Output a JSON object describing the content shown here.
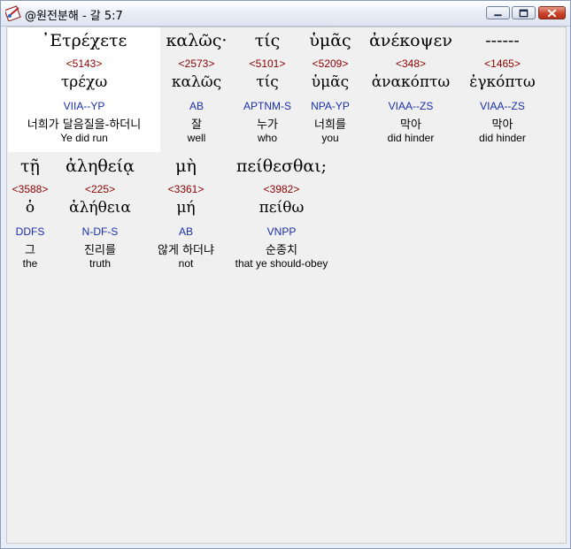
{
  "window": {
    "title": "@원전분해 - 갈 5:7"
  },
  "rows": [
    {
      "words": [
        {
          "greek": "᾿Ετρέχετε",
          "strong": "<5143>",
          "lemma": "τρέχω",
          "parse": "VIIA--YP",
          "korean": "너희가 달음질을-하더니",
          "english": "Ye did run"
        },
        {
          "greek": "καλῶς·",
          "strong": "<2573>",
          "lemma": "καλῶς",
          "parse": "AB",
          "korean": "잘",
          "english": "well"
        },
        {
          "greek": "τίς",
          "strong": "<5101>",
          "lemma": "τίς",
          "parse": "APTNM-S",
          "korean": "누가",
          "english": "who"
        },
        {
          "greek": "ὑμᾶς",
          "strong": "<5209>",
          "lemma": "ὑμᾶς",
          "parse": "NPA-YP",
          "korean": "너희를",
          "english": "you"
        },
        {
          "greek": "ἀνέκοψεν",
          "strong": "<348>",
          "lemma": "ἀνακόπτω",
          "parse": "VIAA--ZS",
          "korean": "막아",
          "english": "did hinder"
        },
        {
          "greek": "------",
          "strong": "<1465>",
          "lemma": "ἐγκόπτω",
          "parse": "VIAA--ZS",
          "korean": "막아",
          "english": "did hinder"
        }
      ]
    },
    {
      "words": [
        {
          "greek": "τῇ",
          "strong": "<3588>",
          "lemma": "ὁ",
          "parse": "DDFS",
          "korean": "그",
          "english": "the"
        },
        {
          "greek": "ἀληθείᾳ",
          "strong": "<225>",
          "lemma": "ἀλήθεια",
          "parse": "N-DF-S",
          "korean": "진리를",
          "english": "truth"
        },
        {
          "greek": "μὴ",
          "strong": "<3361>",
          "lemma": "μή",
          "parse": "AB",
          "korean": "않게 하더냐",
          "english": "not"
        },
        {
          "greek": "πείθεσθαι;",
          "strong": "<3982>",
          "lemma": "πείθω",
          "parse": "VNPP",
          "korean": "순종치",
          "english": "that ye should-obey"
        }
      ]
    }
  ],
  "colors": {
    "strong": "#8b0000",
    "parse": "#1a2fa8",
    "highlight": "#ffffff",
    "client_bg": "#f0f0f0"
  }
}
